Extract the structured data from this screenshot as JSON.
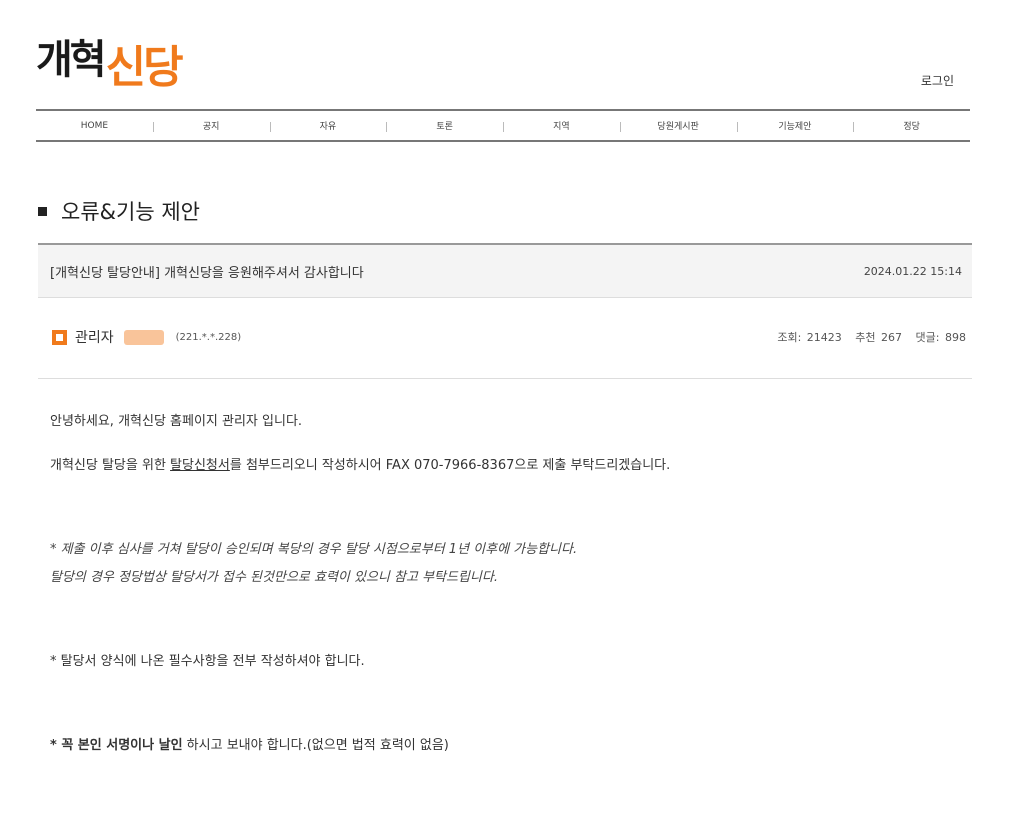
{
  "header": {
    "logo_part1": "개혁",
    "logo_part2": "신당",
    "login_label": "로그인"
  },
  "nav": {
    "items": [
      "HOME",
      "공지",
      "자유",
      "토론",
      "지역",
      "당원게시판",
      "기능제안",
      "정당"
    ]
  },
  "section": {
    "title": "오류&기능 제안"
  },
  "post": {
    "title": "[개혁신당 탈당안내] 개혁신당을 응원해주셔서 감사합니다",
    "datetime": "2024.01.22 15:14",
    "author": "관리자",
    "ip": "(221.*.*.228)",
    "views_label": "조회",
    "views": "21423",
    "recommend_label": "추천",
    "recommend": "267",
    "comments_label": "댓글",
    "comments": "898"
  },
  "content": {
    "line1": "안녕하세요, 개혁신당 홈페이지 관리자 입니다.",
    "line2_pre": "개혁신당 탈당을 위한 ",
    "line2_link": "탈당신청서",
    "line2_post": "를 첨부드리오니 작성하시어 FAX 070-7966-8367으로 제출 부탁드리겠습니다.",
    "note1_a": "* 제출 이후 심사를 거쳐 탈당이 승인되며 복당의 경우 탈당 시점으로부터 1년 이후에 가능합니다.",
    "note1_b": "탈당의 경우 정당법상 탈당서가 접수 된것만으로 효력이 있으니 참고 부탁드립니다.",
    "note2": "* 탈당서 양식에 나온 필수사항을 전부 작성하셔야 합니다.",
    "note3_bold": "* 꼭 본인 서명이나 날인",
    "note3_rest": " 하시고 보내야 합니다.(없으면 법적 효력이 없음)"
  }
}
